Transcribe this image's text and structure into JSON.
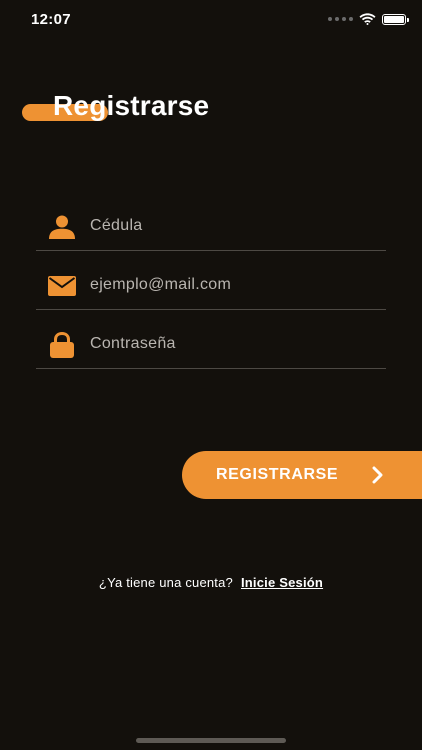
{
  "status_bar": {
    "time": "12:07"
  },
  "header": {
    "title": "Registrarse"
  },
  "form": {
    "fields": [
      {
        "name": "cedula",
        "icon": "user-icon",
        "placeholder": "Cédula",
        "value": ""
      },
      {
        "name": "email",
        "icon": "mail-icon",
        "placeholder": "ejemplo@mail.com",
        "value": ""
      },
      {
        "name": "password",
        "icon": "lock-icon",
        "placeholder": "Contraseña",
        "value": ""
      }
    ],
    "submit_label": "REGISTRARSE",
    "submit_icon": "chevron-right-icon"
  },
  "footer": {
    "question": "¿Ya tiene una cuenta?",
    "login_link": "Inicie Sesión"
  },
  "colors": {
    "background": "#13100c",
    "accent": "#ee9233",
    "text": "#ffffff",
    "placeholder": "#b9b5b0",
    "divider": "#4d4944"
  }
}
